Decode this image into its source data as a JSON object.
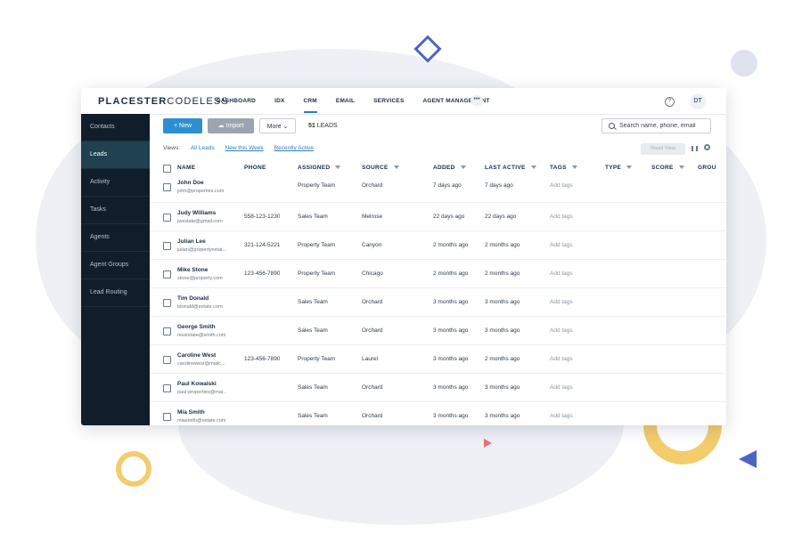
{
  "app": {
    "logo_bold": "PLACESTER",
    "logo_light": "CODELESS",
    "nav": [
      "DASHBOARD",
      "IDX",
      "CRM",
      "EMAIL",
      "SERVICES",
      "AGENT MANAGEMENT"
    ],
    "nav_active": "CRM",
    "nav_more": "•••",
    "help": "?",
    "user_initials": "DT"
  },
  "sidebar": {
    "items": [
      "Contacts",
      "Leads",
      "Activity",
      "Tasks",
      "Agents",
      "Agent Groups",
      "Lead Routing"
    ],
    "active": "Leads"
  },
  "toolbar": {
    "new_label": "New",
    "import_label": "Import",
    "more_label": "More",
    "leads_count": "51",
    "leads_label": "LEADS",
    "search_placeholder": "Search name, phone, email"
  },
  "views": {
    "label": "Views:",
    "items": [
      "All Leads",
      "New this Week",
      "Recently Active"
    ],
    "reset_label": "Reset View"
  },
  "table": {
    "headers": [
      "NAME",
      "PHONE",
      "ASSIGNED",
      "SOURCE",
      "ADDED",
      "LAST ACTIVE",
      "TAGS",
      "TYPE",
      "SCORE",
      "GROU"
    ],
    "rows": [
      {
        "name": "John Doe",
        "email": "john@properties.com",
        "phone": "",
        "assigned": "Property Team",
        "source": "Orchard",
        "added": "7 days ago",
        "last_active": "7 days ago",
        "tags": "Add tags"
      },
      {
        "name": "Judy Williams",
        "email": "jwestate@gmail.com",
        "phone": "558-123-1230",
        "assigned": "Sales Team",
        "source": "Melrose",
        "added": "22 days ago",
        "last_active": "22 days ago",
        "tags": "Add tags"
      },
      {
        "name": "Julian Lee",
        "email": "julian@propertyestat...",
        "phone": "321-124-5221",
        "assigned": "Property Team",
        "source": "Canyon",
        "added": "2 months ago",
        "last_active": "2 months ago",
        "tags": "Add tags"
      },
      {
        "name": "Mike Stone",
        "email": "stone@property.com",
        "phone": "123-456-7890",
        "assigned": "Property Team",
        "source": "Chicago",
        "added": "2 months ago",
        "last_active": "2 months ago",
        "tags": "Add tags"
      },
      {
        "name": "Tim Donald",
        "email": "tdonald@estate.com",
        "phone": "",
        "assigned": "Sales Team",
        "source": "Orchard",
        "added": "3 months ago",
        "last_active": "3 months ago",
        "tags": "Add tags"
      },
      {
        "name": "George Smith",
        "email": "resiestate@smith.com",
        "phone": "",
        "assigned": "Sales Team",
        "source": "Orchard",
        "added": "3 months ago",
        "last_active": "3 months ago",
        "tags": "Add tags"
      },
      {
        "name": "Caroline West",
        "email": "carolinewest@mailc...",
        "phone": "123-456-7890",
        "assigned": "Property Team",
        "source": "Laurel",
        "added": "3 months ago",
        "last_active": "2 months ago",
        "tags": "Add tags"
      },
      {
        "name": "Paul Kowalski",
        "email": "paul-properties@mai...",
        "phone": "",
        "assigned": "Sales Team",
        "source": "Orchard",
        "added": "3 months ago",
        "last_active": "3 months ago",
        "tags": "Add tags"
      },
      {
        "name": "Mia Smith",
        "email": "miasmith@estate.com",
        "phone": "",
        "assigned": "Sales Team",
        "source": "Orchard",
        "added": "3 months ago",
        "last_active": "3 months ago",
        "tags": "Add tags"
      }
    ]
  },
  "colors": {
    "primary": "#2d8fd0",
    "sidebar_bg": "#0f1e2a",
    "sidebar_active": "#1f4150",
    "accent_yellow": "#f3cc6d",
    "accent_blue": "#4a66c2"
  }
}
